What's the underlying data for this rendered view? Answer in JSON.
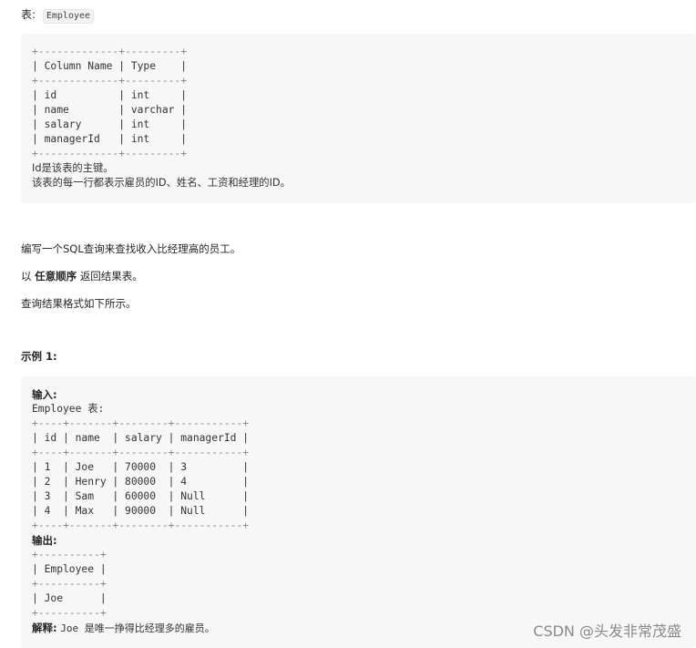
{
  "header": {
    "prefix": "表:",
    "table_name": "Employee"
  },
  "schema": {
    "rows": [
      "+-------------+---------+",
      "| Column Name | Type    |",
      "+-------------+---------+",
      "| id          | int     |",
      "| name        | varchar |",
      "| salary      | int     |",
      "| managerId   | int     |",
      "+-------------+---------+"
    ],
    "note1": "Id是该表的主键。",
    "note2": "该表的每一行都表示雇员的ID、姓名、工资和经理的ID。"
  },
  "problem": {
    "p1": "编写一个SQL查询来查找收入比经理高的员工。",
    "p2_prefix": "以",
    "p2_bold": "任意顺序",
    "p2_suffix": "返回结果表。",
    "p3": "查询结果格式如下所示。"
  },
  "example": {
    "heading": "示例 1:",
    "input_label": "输入:",
    "input_caption": "Employee 表:",
    "input_rows": [
      "+----+-------+--------+-----------+",
      "| id | name  | salary | managerId |",
      "+----+-------+--------+-----------+",
      "| 1  | Joe   | 70000  | 3         |",
      "| 2  | Henry | 80000  | 4         |",
      "| 3  | Sam   | 60000  | Null      |",
      "| 4  | Max   | 90000  | Null      |",
      "+----+-------+--------+-----------+"
    ],
    "output_label": "输出:",
    "output_rows": [
      "+----------+",
      "| Employee |",
      "+----------+",
      "| Joe      |",
      "+----------+"
    ],
    "explain_label": "解释:",
    "explain_text": "Joe 是唯一挣得比经理多的雇员。"
  },
  "watermark": "CSDN @头发非常茂盛"
}
